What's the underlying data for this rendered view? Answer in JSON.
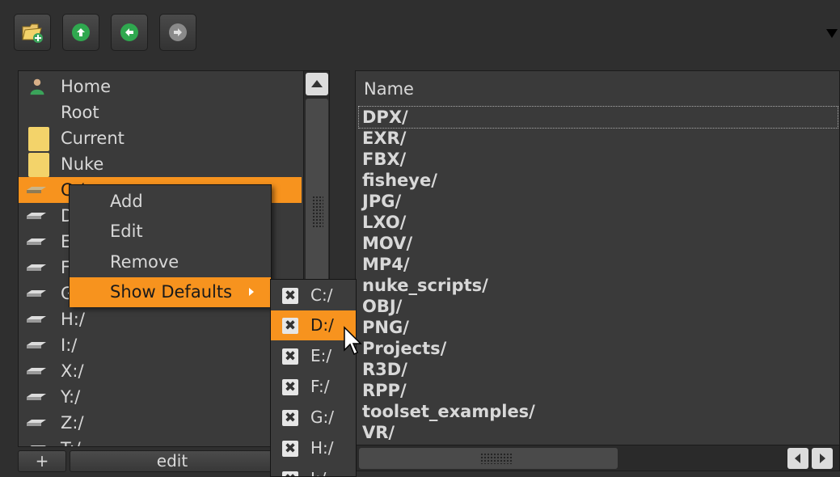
{
  "toolbar": {
    "buttons": [
      {
        "icon": "new-folder-icon"
      },
      {
        "icon": "up-arrow-icon"
      },
      {
        "icon": "back-arrow-icon"
      },
      {
        "icon": "forward-arrow-icon"
      }
    ]
  },
  "favorites": {
    "items": [
      {
        "label": "Home",
        "icon": "user-icon"
      },
      {
        "label": "Root",
        "icon": ""
      },
      {
        "label": "Current",
        "icon": "folder-icon"
      },
      {
        "label": "Nuke",
        "icon": "folder-icon"
      },
      {
        "label": "C:/",
        "icon": "drive-icon",
        "selected": true
      },
      {
        "label": "D:/",
        "icon": "drive-icon"
      },
      {
        "label": "E:/",
        "icon": "drive-icon"
      },
      {
        "label": "F:/",
        "icon": "drive-icon"
      },
      {
        "label": "G:/",
        "icon": "drive-icon"
      },
      {
        "label": "H:/",
        "icon": "drive-icon"
      },
      {
        "label": "I:/",
        "icon": "drive-icon"
      },
      {
        "label": "X:/",
        "icon": "drive-icon"
      },
      {
        "label": "Y:/",
        "icon": "drive-icon"
      },
      {
        "label": "Z:/",
        "icon": "drive-icon"
      },
      {
        "label": "T:/",
        "icon": "drive-icon"
      }
    ],
    "add_label": "+",
    "edit_label": "edit"
  },
  "context_menu": {
    "items": [
      "Add",
      "Edit",
      "Remove",
      "Show Defaults"
    ],
    "highlighted": "Show Defaults"
  },
  "submenu": {
    "items": [
      "C:/",
      "D:/",
      "E:/",
      "F:/",
      "G:/",
      "H:/",
      "I:/"
    ],
    "highlighted": "D:/"
  },
  "file_list": {
    "header": "Name",
    "entries": [
      "DPX/",
      "EXR/",
      "FBX/",
      "fisheye/",
      "JPG/",
      "LXO/",
      "MOV/",
      "MP4/",
      "nuke_scripts/",
      "OBJ/",
      "PNG/",
      "Projects/",
      "R3D/",
      "RPP/",
      "toolset_examples/",
      "VR/"
    ]
  },
  "colors": {
    "highlight": "#f7931e",
    "panel": "#3a3a3a",
    "background": "#2f2f2f"
  }
}
